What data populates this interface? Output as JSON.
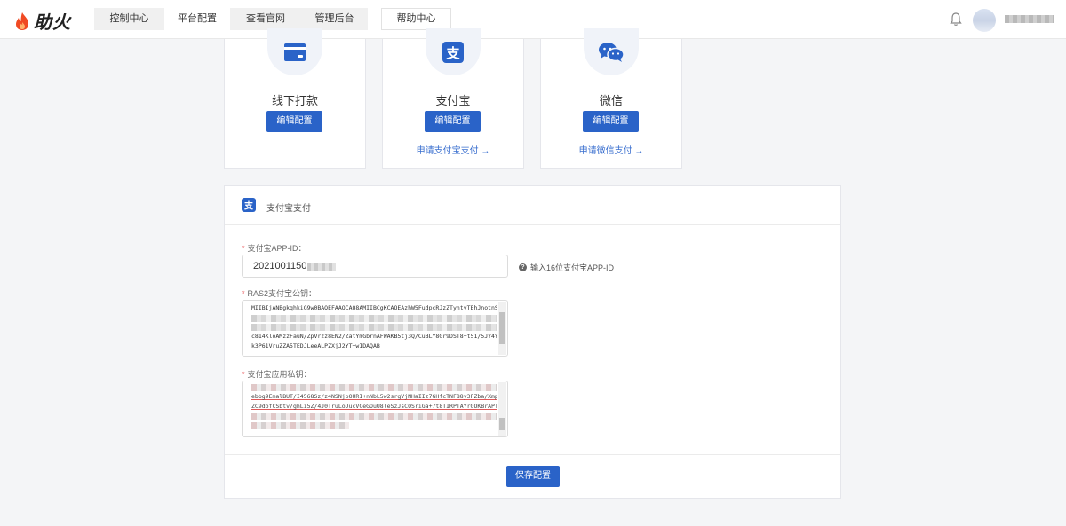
{
  "app": {
    "name": "助火"
  },
  "nav": {
    "tabs": [
      {
        "label": "控制中心"
      },
      {
        "label": "平台配置",
        "active": true
      },
      {
        "label": "查看官网"
      },
      {
        "label": "管理后台"
      }
    ],
    "help_label": "帮助中心"
  },
  "payment_methods": [
    {
      "title": "线下打款",
      "button_label": "编辑配置",
      "icon": "card-icon"
    },
    {
      "title": "支付宝",
      "button_label": "编辑配置",
      "link_label": "申请支付宝支付 →",
      "icon": "alipay-icon"
    },
    {
      "title": "微信",
      "button_label": "编辑配置",
      "link_label": "申请微信支付 →",
      "icon": "wechat-icon"
    }
  ],
  "config_panel": {
    "title": "支付宝支付",
    "app_id": {
      "label": "支付宝APP-ID：",
      "value": "2021001150",
      "hint": "输入16位支付宝APP-ID"
    },
    "public_key": {
      "label": "RAS2支付宝公钥：",
      "lines": [
        "MIIBIjANBgkqhkiG9w0BAQEFAAOCAQ8AMIIBCgKCAQEAzhW5FudpcRJzZTyntvTEhJnotnS",
        "c814KloAMzzFauN/ZpVrzz8EN2/ZatYmGbrnAFWAKB5tj3Q/CuBLY8Gr9DST8+t51/5JY4Y",
        "k3P61VruZZA5TEDJLeeALPZXjJ2YT+wIDAQAB"
      ]
    },
    "private_key": {
      "label": "支付宝应用私钥：",
      "lines": [
        "ebbg9EmalBUT/I4568Sz/z4NSNjpOURI+nNbL5w2srgVjNHaIIz7GHfcTNF88y3FZba/Xmp",
        "ZC9dbfCSbtv/ghLi5Z/4J0TruLoJucVCeGOuU8leSzJsCOSriGa+7t8TIRPTAYrGOKBrAPT"
      ]
    },
    "save_label": "保存配置"
  },
  "colors": {
    "primary": "#2a63c8",
    "link": "#3a6fcf",
    "required": "#e4393c",
    "logo_flame": "#f04a23"
  }
}
